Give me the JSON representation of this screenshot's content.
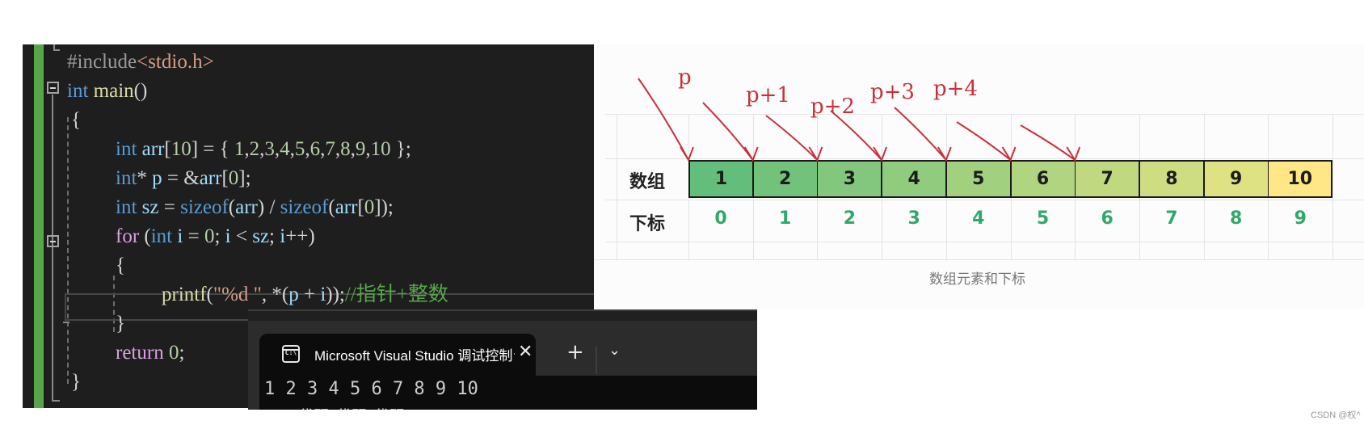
{
  "editor": {
    "lines": [
      {
        "tokens": [
          {
            "c": "pp",
            "t": "#include"
          },
          {
            "c": "inc",
            "t": "<stdio.h>"
          }
        ]
      },
      {
        "tokens": [
          {
            "c": "kw",
            "t": "int"
          },
          {
            "c": "pun",
            "t": " "
          },
          {
            "c": "fn",
            "t": "main"
          },
          {
            "c": "pun",
            "t": "()"
          }
        ]
      },
      {
        "tokens": [
          {
            "c": "pun",
            "t": "{"
          }
        ]
      },
      {
        "tokens": [
          {
            "c": "kw",
            "t": "int"
          },
          {
            "c": "pun",
            "t": " "
          },
          {
            "c": "var",
            "t": "arr"
          },
          {
            "c": "pun",
            "t": "["
          },
          {
            "c": "num",
            "t": "10"
          },
          {
            "c": "pun",
            "t": "] = { "
          },
          {
            "c": "num",
            "t": "1"
          },
          {
            "c": "pun",
            "t": ","
          },
          {
            "c": "num",
            "t": "2"
          },
          {
            "c": "pun",
            "t": ","
          },
          {
            "c": "num",
            "t": "3"
          },
          {
            "c": "pun",
            "t": ","
          },
          {
            "c": "num",
            "t": "4"
          },
          {
            "c": "pun",
            "t": ","
          },
          {
            "c": "num",
            "t": "5"
          },
          {
            "c": "pun",
            "t": ","
          },
          {
            "c": "num",
            "t": "6"
          },
          {
            "c": "pun",
            "t": ","
          },
          {
            "c": "num",
            "t": "7"
          },
          {
            "c": "pun",
            "t": ","
          },
          {
            "c": "num",
            "t": "8"
          },
          {
            "c": "pun",
            "t": ","
          },
          {
            "c": "num",
            "t": "9"
          },
          {
            "c": "pun",
            "t": ","
          },
          {
            "c": "num",
            "t": "10"
          },
          {
            "c": "pun",
            "t": " };"
          }
        ]
      },
      {
        "tokens": [
          {
            "c": "kw",
            "t": "int"
          },
          {
            "c": "pun",
            "t": "* "
          },
          {
            "c": "var",
            "t": "p"
          },
          {
            "c": "pun",
            "t": " = &"
          },
          {
            "c": "var",
            "t": "arr"
          },
          {
            "c": "pun",
            "t": "["
          },
          {
            "c": "num",
            "t": "0"
          },
          {
            "c": "pun",
            "t": "];"
          }
        ]
      },
      {
        "tokens": [
          {
            "c": "kw",
            "t": "int"
          },
          {
            "c": "pun",
            "t": " "
          },
          {
            "c": "var",
            "t": "sz"
          },
          {
            "c": "pun",
            "t": " = "
          },
          {
            "c": "kw",
            "t": "sizeof"
          },
          {
            "c": "pun",
            "t": "("
          },
          {
            "c": "var",
            "t": "arr"
          },
          {
            "c": "pun",
            "t": ") / "
          },
          {
            "c": "kw",
            "t": "sizeof"
          },
          {
            "c": "pun",
            "t": "("
          },
          {
            "c": "var",
            "t": "arr"
          },
          {
            "c": "pun",
            "t": "["
          },
          {
            "c": "num",
            "t": "0"
          },
          {
            "c": "pun",
            "t": "]);"
          }
        ]
      },
      {
        "tokens": [
          {
            "c": "ctl",
            "t": "for"
          },
          {
            "c": "pun",
            "t": " ("
          },
          {
            "c": "kw",
            "t": "int"
          },
          {
            "c": "pun",
            "t": " "
          },
          {
            "c": "var",
            "t": "i"
          },
          {
            "c": "pun",
            "t": " = "
          },
          {
            "c": "num",
            "t": "0"
          },
          {
            "c": "pun",
            "t": "; "
          },
          {
            "c": "var",
            "t": "i"
          },
          {
            "c": "pun",
            "t": " < "
          },
          {
            "c": "var",
            "t": "sz"
          },
          {
            "c": "pun",
            "t": "; "
          },
          {
            "c": "var",
            "t": "i"
          },
          {
            "c": "pun",
            "t": "++)"
          }
        ]
      },
      {
        "tokens": [
          {
            "c": "pun",
            "t": "{"
          }
        ]
      },
      {
        "tokens": [
          {
            "c": "fn",
            "t": "printf"
          },
          {
            "c": "pun",
            "t": "("
          },
          {
            "c": "str",
            "t": "\"%d \""
          },
          {
            "c": "pun",
            "t": ", *("
          },
          {
            "c": "var",
            "t": "p"
          },
          {
            "c": "pun",
            "t": " + "
          },
          {
            "c": "var",
            "t": "i"
          },
          {
            "c": "pun",
            "t": "));"
          },
          {
            "c": "cmt",
            "t": "//指针+整数"
          }
        ]
      },
      {
        "tokens": [
          {
            "c": "pun",
            "t": "}"
          }
        ]
      },
      {
        "tokens": [
          {
            "c": "ctl",
            "t": "return"
          },
          {
            "c": "pun",
            "t": " "
          },
          {
            "c": "num",
            "t": "0"
          },
          {
            "c": "pun",
            "t": ";"
          }
        ]
      },
      {
        "tokens": [
          {
            "c": "pun",
            "t": "}"
          }
        ]
      }
    ]
  },
  "terminal": {
    "tab_title": "Microsoft Visual Studio 调试控制台",
    "tab_icon": "console-icon",
    "close_label": "✕",
    "new_tab_label": "+",
    "dropdown_label": "⌄",
    "output": "1 2 3 4 5 6 7 8 9 10",
    "output_partial": "  D:\\代码\\代码\\代码\\..."
  },
  "diagram": {
    "row_label_values": "数组",
    "row_label_indices": "下标",
    "values": [
      "1",
      "2",
      "3",
      "4",
      "5",
      "6",
      "7",
      "8",
      "9",
      "10"
    ],
    "indices": [
      "0",
      "1",
      "2",
      "3",
      "4",
      "5",
      "6",
      "7",
      "8",
      "9"
    ],
    "cell_colors": [
      "#63be7b",
      "#72c27c",
      "#82c77d",
      "#91cb7e",
      "#a1d07f",
      "#b0d47f",
      "#c0d980",
      "#cfdd82",
      "#dfe283",
      "#fee784"
    ],
    "pointer_labels": [
      "p",
      "p+1",
      "p+2",
      "p+3",
      "p+4"
    ],
    "caption": "数组元素和下标",
    "annotation_color": "#c8303c"
  },
  "watermark": "CSDN @权^"
}
